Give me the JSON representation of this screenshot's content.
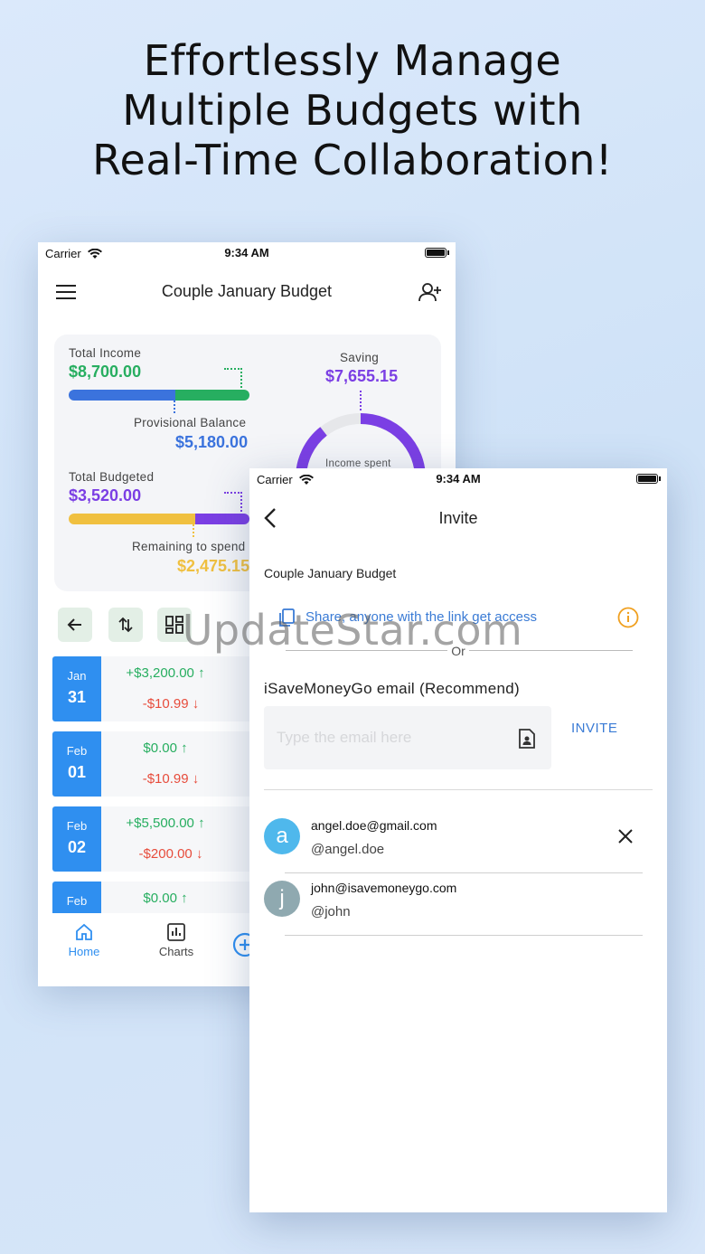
{
  "headline": [
    "Effortlessly Manage",
    "Multiple Budgets with",
    "Real-Time Collaboration!"
  ],
  "back_screen": {
    "status": {
      "carrier": "Carrier",
      "time": "9:34 AM"
    },
    "title": "Couple January Budget",
    "summary": {
      "total_income_label": "Total Income",
      "total_income": "$8,700.00",
      "income_bar_fraction": 0.59,
      "provisional_balance_label": "Provisional Balance",
      "provisional_balance": "$5,180.00",
      "total_budgeted_label": "Total Budgeted",
      "total_budgeted": "$3,520.00",
      "budget_bar_fraction": 0.7,
      "remaining_label": "Remaining to spend",
      "remaining": "$2,475.15",
      "saving_label": "Saving",
      "saving": "$7,655.15",
      "ring_label": "Income spent"
    },
    "days": [
      {
        "month": "Jan",
        "day": "31",
        "income": "+$3,200.00",
        "expense": "-$10.99"
      },
      {
        "month": "Feb",
        "day": "01",
        "income": "$0.00",
        "expense": "-$10.99"
      },
      {
        "month": "Feb",
        "day": "02",
        "income": "+$5,500.00",
        "expense": "-$200.00"
      },
      {
        "month": "Feb",
        "day": "",
        "income": "$0.00",
        "expense": ""
      }
    ],
    "nav": {
      "home": "Home",
      "charts": "Charts"
    },
    "colors": {
      "blue": "#3b73dd",
      "green": "#27ae60",
      "purple": "#7b3fe4",
      "yellow": "#f0c040",
      "accent": "#2f8ff0"
    }
  },
  "front_screen": {
    "status": {
      "carrier": "Carrier",
      "time": "9:34 AM"
    },
    "title": "Invite",
    "budget_name": "Couple January Budget",
    "share_text": "Share, anyone with the link get access",
    "or_text": "Or",
    "email_label": "iSaveMoneyGo email (Recommend)",
    "email_placeholder": "Type the email here",
    "invite_label": "INVITE",
    "members": [
      {
        "initial": "a",
        "email": "angel.doe@gmail.com",
        "handle": "@angel.doe",
        "color": "#4fb8ec"
      },
      {
        "initial": "j",
        "email": "john@isavemoneygo.com",
        "handle": "@john",
        "color": "#8fa9b0"
      }
    ]
  },
  "watermark": "UpdateStar.com"
}
